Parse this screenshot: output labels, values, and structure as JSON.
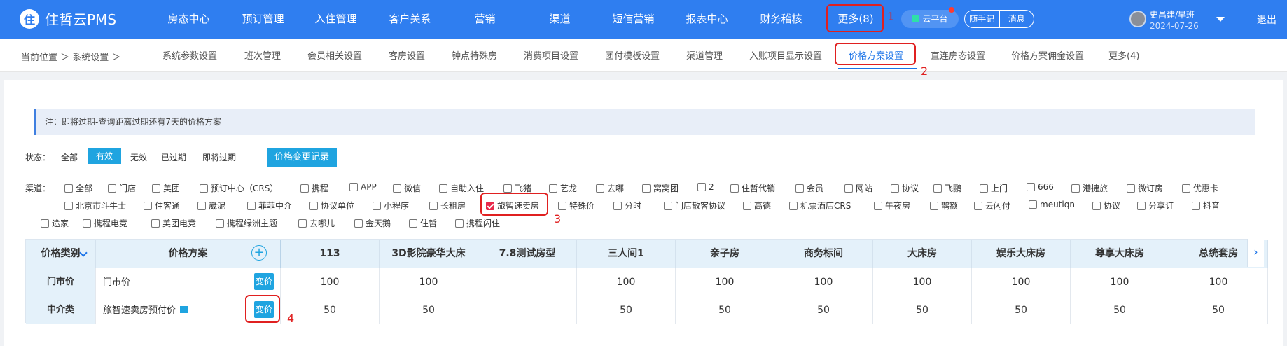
{
  "app": {
    "logo_mark": "住",
    "name": "住哲云PMS"
  },
  "topnav": [
    {
      "label": "房态中心"
    },
    {
      "label": "预订管理"
    },
    {
      "label": "入住管理"
    },
    {
      "label": "客户关系"
    },
    {
      "label": "营销"
    },
    {
      "label": "渠道"
    },
    {
      "label": "短信营销"
    },
    {
      "label": "报表中心"
    },
    {
      "label": "财务稽核"
    },
    {
      "label": "更多(8)"
    }
  ],
  "top_right": {
    "cloud": "云平台",
    "note": "随手记",
    "message": "消息",
    "user": "史昌建/早班",
    "date": "2024-07-26",
    "logout": "退出"
  },
  "breadcrumb": "当前位置 ＞ 系统设置 ＞",
  "subnav": [
    {
      "label": "系统参数设置"
    },
    {
      "label": "班次管理"
    },
    {
      "label": "会员相关设置"
    },
    {
      "label": "客房设置"
    },
    {
      "label": "钟点特殊房"
    },
    {
      "label": "消费项目设置"
    },
    {
      "label": "团付模板设置"
    },
    {
      "label": "渠道管理"
    },
    {
      "label": "入账项目显示设置"
    },
    {
      "label": "价格方案设置"
    },
    {
      "label": "直连房态设置"
    },
    {
      "label": "价格方案佣金设置"
    },
    {
      "label": "更多(4)"
    }
  ],
  "notice": "注：即将过期-查询距离过期还有7天的价格方案",
  "status": {
    "label": "状态：",
    "options": [
      "全部",
      "有效",
      "无效",
      "已过期",
      "即将过期"
    ],
    "active": "有效",
    "log_button": "价格变更记录"
  },
  "channels": {
    "label": "渠道：",
    "items": [
      {
        "name": "全部",
        "checked": false
      },
      {
        "name": "门店",
        "checked": false
      },
      {
        "name": "美团",
        "checked": false
      },
      {
        "name": "预订中心（CRS）",
        "checked": false
      },
      {
        "name": "携程",
        "checked": false
      },
      {
        "name": "APP",
        "checked": false
      },
      {
        "name": "微信",
        "checked": false
      },
      {
        "name": "自助入住",
        "checked": false
      },
      {
        "name": "飞猪",
        "checked": false
      },
      {
        "name": "艺龙",
        "checked": false
      },
      {
        "name": "去哪",
        "checked": false
      },
      {
        "name": "窝窝团",
        "checked": false
      },
      {
        "name": "2",
        "checked": false
      },
      {
        "name": "住哲代销",
        "checked": false
      },
      {
        "name": "会员",
        "checked": false
      },
      {
        "name": "网站",
        "checked": false
      },
      {
        "name": "协议",
        "checked": false
      },
      {
        "name": "飞鹂",
        "checked": false
      },
      {
        "name": "上门",
        "checked": false
      },
      {
        "name": "666",
        "checked": false
      },
      {
        "name": "港捷旅",
        "checked": false
      },
      {
        "name": "微订房",
        "checked": false
      },
      {
        "name": "优惠卡",
        "checked": false
      },
      {
        "name": "北京市斗牛士",
        "checked": false
      },
      {
        "name": "住客通",
        "checked": false
      },
      {
        "name": "崴泥",
        "checked": false
      },
      {
        "name": "菲菲中介",
        "checked": false
      },
      {
        "name": "协议单位",
        "checked": false
      },
      {
        "name": "小程序",
        "checked": false
      },
      {
        "name": "长租房",
        "checked": false
      },
      {
        "name": "旅智速卖房",
        "checked": true
      },
      {
        "name": "特殊价",
        "checked": false
      },
      {
        "name": "分时",
        "checked": false
      },
      {
        "name": "门店散客协议",
        "checked": false
      },
      {
        "name": "高德",
        "checked": false
      },
      {
        "name": "机票酒店CRS",
        "checked": false
      },
      {
        "name": "午夜房",
        "checked": false
      },
      {
        "name": "鹊额",
        "checked": false
      },
      {
        "name": "云闪付",
        "checked": false
      },
      {
        "name": "meutiqn",
        "checked": false
      },
      {
        "name": "协议",
        "checked": false
      },
      {
        "name": "分享订",
        "checked": false
      },
      {
        "name": "抖音",
        "checked": false
      },
      {
        "name": "途家",
        "checked": false
      },
      {
        "name": "携程电竞",
        "checked": false
      },
      {
        "name": "美团电竞",
        "checked": false
      },
      {
        "name": "携程绿洲主题",
        "checked": false
      },
      {
        "name": "去哪儿",
        "checked": false
      },
      {
        "name": "金天鹅",
        "checked": false
      },
      {
        "name": "住哲",
        "checked": false
      },
      {
        "name": "携程闪住",
        "checked": false
      }
    ]
  },
  "table": {
    "col_category": "价格类别",
    "col_plan": "价格方案",
    "add_icon": "+",
    "scroll_icon": "›",
    "room_types": [
      "113",
      "3D影院豪华大床",
      "7.8测试房型",
      "三人间1",
      "亲子房",
      "商务标间",
      "大床房",
      "娱乐大床房",
      "尊享大床房",
      "总统套房"
    ],
    "rows": [
      {
        "category": "门市价",
        "plan": "门市价",
        "button": "变价",
        "prices": [
          "100",
          "100",
          "",
          "100",
          "100",
          "100",
          "100",
          "100",
          "100",
          "100"
        ]
      },
      {
        "category": "中介类",
        "plan": "旅智速卖房预付价",
        "button": "变价",
        "prices": [
          "50",
          "50",
          "",
          "50",
          "50",
          "50",
          "50",
          "50",
          "50",
          "50"
        ]
      }
    ]
  },
  "annotations": [
    "1",
    "2",
    "3",
    "4"
  ],
  "colors": {
    "primary": "#2f7ef0",
    "accent": "#1fa4e0",
    "highlight": "#e02020"
  }
}
